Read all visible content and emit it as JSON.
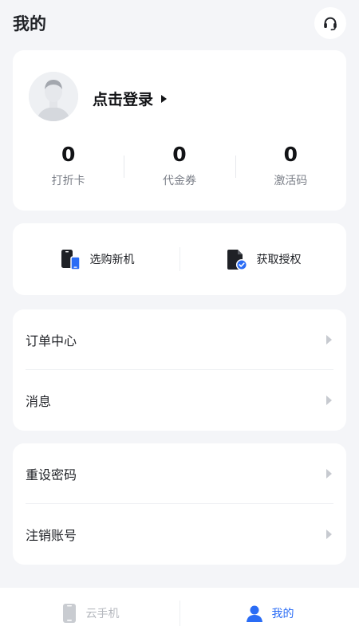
{
  "header": {
    "title": "我的"
  },
  "profile": {
    "login_label": "点击登录",
    "stats": [
      {
        "value": "0",
        "label": "打折卡"
      },
      {
        "value": "0",
        "label": "代金券"
      },
      {
        "value": "0",
        "label": "激活码"
      }
    ]
  },
  "actions": [
    {
      "label": "选购新机",
      "icon": "phone-devices-icon"
    },
    {
      "label": "获取授权",
      "icon": "document-check-icon"
    }
  ],
  "menu_group_1": [
    {
      "label": "订单中心"
    },
    {
      "label": "消息"
    }
  ],
  "menu_group_2": [
    {
      "label": "重设密码"
    },
    {
      "label": "注销账号"
    }
  ],
  "tabbar": [
    {
      "label": "云手机",
      "active": false,
      "icon": "phone-icon"
    },
    {
      "label": "我的",
      "active": true,
      "icon": "user-icon"
    }
  ],
  "colors": {
    "accent": "#2a6cf5",
    "background": "#f4f5f8",
    "card": "#ffffff"
  }
}
